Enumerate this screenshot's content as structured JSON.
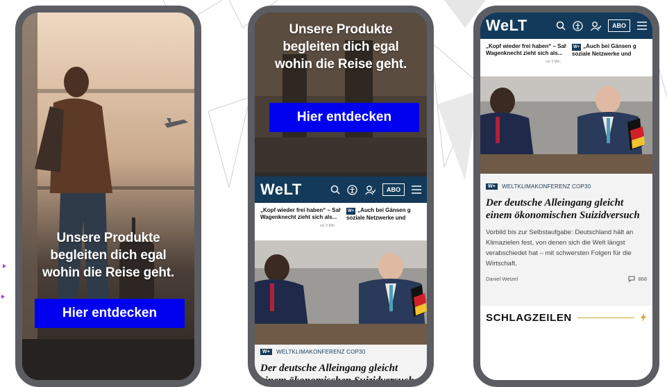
{
  "hero": {
    "headline_line1": "Unsere Produkte",
    "headline_line2": "begleiten dich egal",
    "headline_line3": "wohin die Reise geht.",
    "cta_label": "Hier entdecken"
  },
  "welt": {
    "logo": "WeLT",
    "abo_label": "ABO",
    "teasers": [
      {
        "title_line1": "„Kopf wieder frei haben“ – Sahra",
        "title_line2": "Wagenknecht zieht sich als...",
        "time": "vor 3 Min."
      },
      {
        "badge": "W+",
        "title_line1": "„Auch bei Gänsen g",
        "title_line2": "soziale Netzwerke und"
      }
    ],
    "article": {
      "badge": "W+",
      "kicker": "WELTKLIMAKONFERENZ COP30",
      "headline_line1": "Der deutsche Alleingang gleicht",
      "headline_line2": "einem ökonomischen Suizidversuch",
      "summary": "Vorbild bis zur Selbstaufgabe: Deutschland hält an Klimazielen fest, von denen sich die Welt längst verabschiedet hat – mit schwersten Folgen für die Wirtschaft.",
      "author": "Daniel Wetzel",
      "comments": "868"
    },
    "section_title": "SCHLAGZEILEN"
  },
  "colors": {
    "welt_navy": "#133a5a",
    "cta_blue": "#0000ee",
    "frame": "#5b5d62",
    "accent_gold": "#c9a227"
  }
}
